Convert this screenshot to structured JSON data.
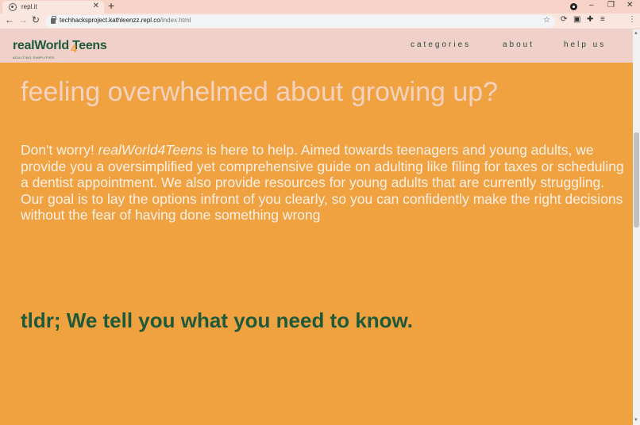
{
  "browser": {
    "tab_title": "repl.it",
    "tab_close": "✕",
    "new_tab": "+",
    "url_host": "techhacksproject.kathleenzz.repl.co",
    "url_path": "/index.html",
    "window_controls": {
      "minimize": "–",
      "restore": "❐",
      "close": "✕"
    }
  },
  "site": {
    "logo": {
      "text": "realWorld Teens",
      "four": "4",
      "tagline": "ADULTING SIMPLIFIED"
    },
    "nav": [
      "categories",
      "about",
      "help us"
    ],
    "hero_title": "feeling overwhelmed about growing up?",
    "intro": {
      "before": "Don't worry! ",
      "brand": "realWorld4Teens",
      "after": " is here to help. Aimed towards teenagers and young adults, we provide you a oversimplified yet comprehensive guide on adulting like filing for taxes or scheduling a dentist appointment. We also provide resources for young adults that are currently struggling. Our goal is to lay the options infront of you clearly, so you can confidently make the right decisions without the fear of having done something wrong"
    },
    "tldr": "tldr; We tell you what you need to know."
  },
  "colors": {
    "page_background": "#f0a140",
    "header_background": "#f0d1c9",
    "brand_green": "#1e5a3a",
    "hero_title": "#f4d2c0"
  }
}
